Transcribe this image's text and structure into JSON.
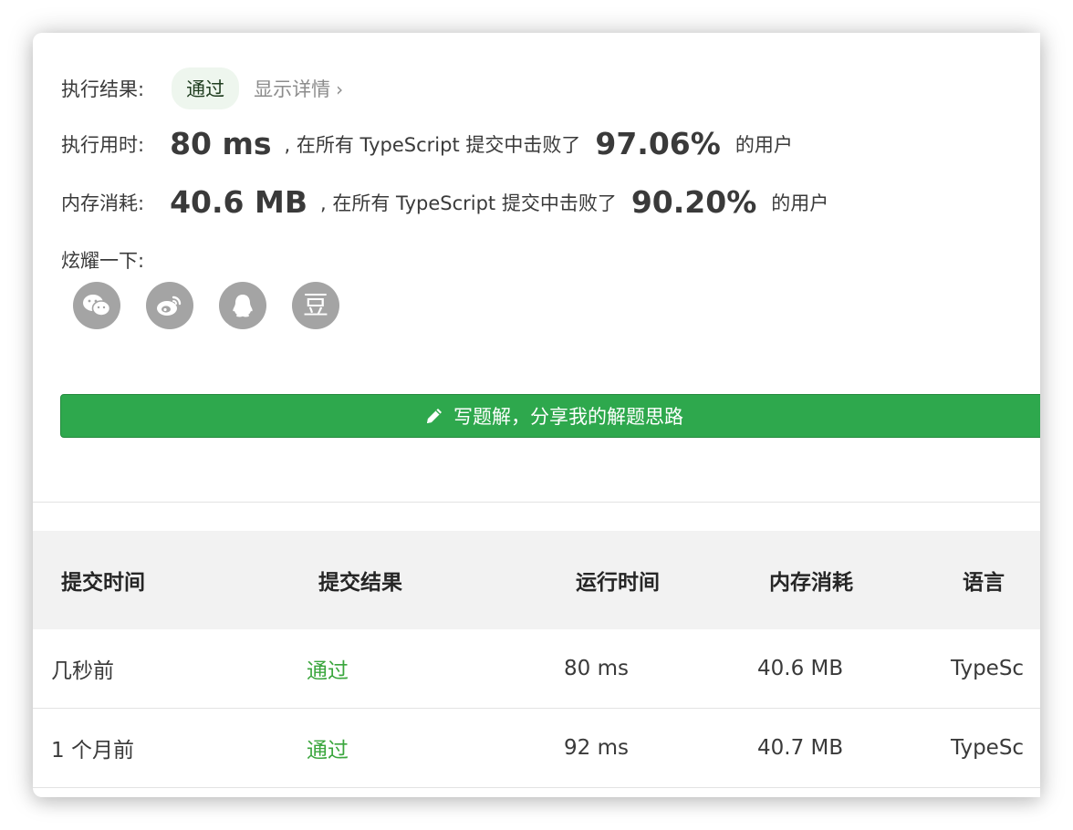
{
  "result": {
    "label": "执行结果:",
    "status": "通过",
    "detail_link": "显示详情",
    "detail_chevron": "›"
  },
  "runtime": {
    "label": "执行用时:",
    "value": "80 ms",
    "middle": ", 在所有 TypeScript 提交中击败了",
    "percent": "97.06%",
    "suffix": "的用户"
  },
  "memory": {
    "label": "内存消耗:",
    "value": "40.6 MB",
    "middle": ", 在所有 TypeScript 提交中击败了",
    "percent": "90.20%",
    "suffix": "的用户"
  },
  "share": {
    "label": "炫耀一下:",
    "icons": [
      "wechat-icon",
      "weibo-icon",
      "qq-icon",
      "douban-icon"
    ],
    "douban_glyph": "豆"
  },
  "solution_button": {
    "icon": "pencil-icon",
    "label": "写题解，分享我的解题思路"
  },
  "table": {
    "headers": [
      "提交时间",
      "提交结果",
      "运行时间",
      "内存消耗",
      "语言"
    ],
    "rows": [
      [
        "几秒前",
        "通过",
        "80 ms",
        "40.6 MB",
        "TypeSc"
      ],
      [
        "1 个月前",
        "通过",
        "92 ms",
        "40.7 MB",
        "TypeSc"
      ]
    ]
  },
  "colors": {
    "accent_green": "#2ea84d",
    "pass_text": "#3aa63d",
    "badge_bg": "#eef6ee",
    "share_icon_bg": "#a4a4a4"
  }
}
